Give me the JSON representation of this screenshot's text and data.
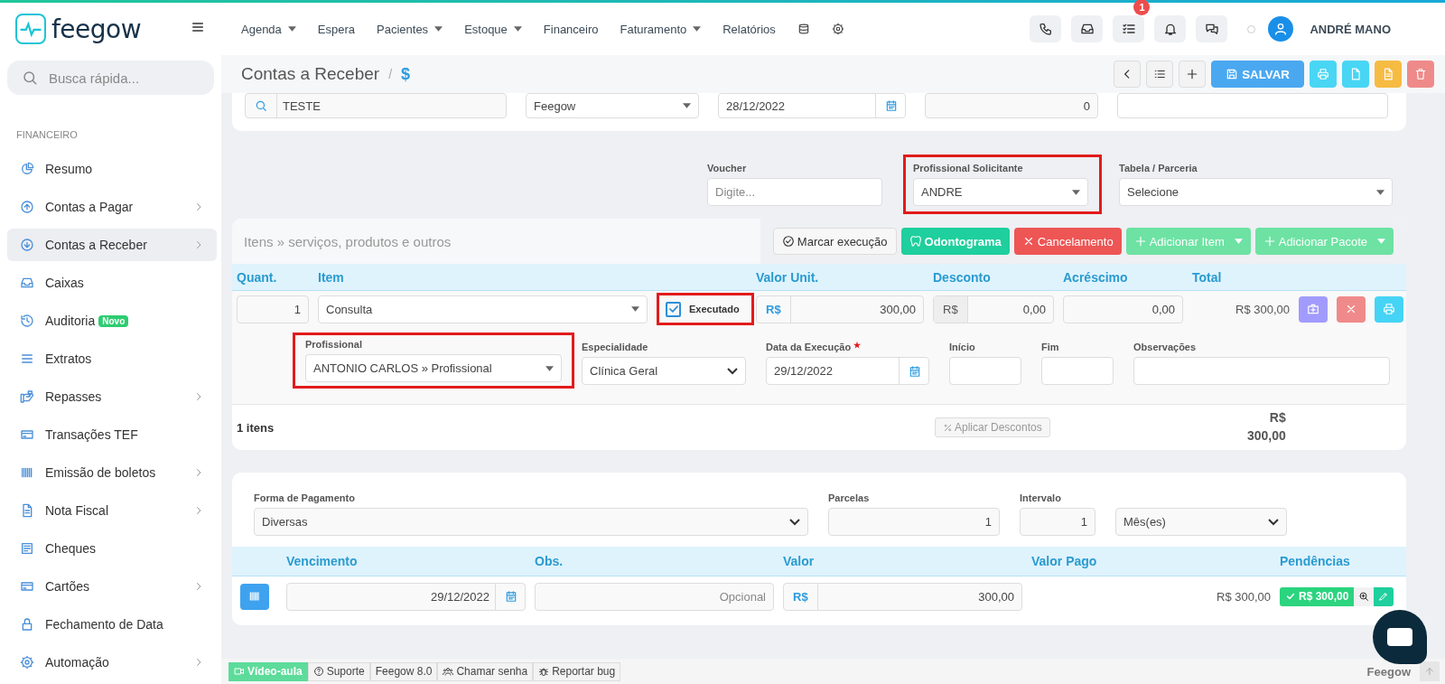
{
  "header": {
    "logo": "feegow",
    "nav": [
      {
        "label": "Agenda",
        "dropdown": true
      },
      {
        "label": "Espera",
        "dropdown": false
      },
      {
        "label": "Pacientes",
        "dropdown": true
      },
      {
        "label": "Estoque",
        "dropdown": true
      },
      {
        "label": "Financeiro",
        "dropdown": false
      },
      {
        "label": "Faturamento",
        "dropdown": true
      },
      {
        "label": "Relatórios",
        "dropdown": false
      }
    ],
    "nav_icons": [
      {
        "kind": "database"
      },
      {
        "kind": "settings"
      }
    ],
    "actions": [
      {
        "kind": "phone"
      },
      {
        "kind": "inbox"
      },
      {
        "kind": "tasks",
        "badge": "1"
      },
      {
        "kind": "bell"
      },
      {
        "kind": "chat"
      }
    ],
    "user": "ANDRÉ MANO"
  },
  "sidebar": {
    "search_placeholder": "Busca rápida...",
    "section": "FINANCEIRO",
    "items": [
      {
        "label": "Resumo",
        "kind": "pie",
        "expandable": false,
        "selected": false
      },
      {
        "label": "Contas a Pagar",
        "kind": "up",
        "expandable": true,
        "selected": false
      },
      {
        "label": "Contas a Receber",
        "kind": "down",
        "expandable": true,
        "selected": true
      },
      {
        "label": "Caixas",
        "kind": "inbox",
        "expandable": false,
        "selected": false
      },
      {
        "label": "Auditoria",
        "kind": "history",
        "expandable": false,
        "selected": false,
        "badge": "Novo"
      },
      {
        "label": "Extratos",
        "kind": "lines",
        "expandable": false,
        "selected": false
      },
      {
        "label": "Repasses",
        "kind": "hand",
        "expandable": true,
        "selected": false
      },
      {
        "label": "Transações TEF",
        "kind": "card",
        "expandable": false,
        "selected": false
      },
      {
        "label": "Emissão de boletos",
        "kind": "barcode",
        "expandable": true,
        "selected": false
      },
      {
        "label": "Nota Fiscal",
        "kind": "doc",
        "expandable": true,
        "selected": false
      },
      {
        "label": "Cheques",
        "kind": "receipt",
        "expandable": false,
        "selected": false
      },
      {
        "label": "Cartões",
        "kind": "card",
        "expandable": true,
        "selected": false
      },
      {
        "label": "Fechamento de Data",
        "kind": "lock",
        "expandable": false,
        "selected": false
      },
      {
        "label": "Automação",
        "kind": "settings",
        "expandable": true,
        "selected": false
      }
    ]
  },
  "page": {
    "title": "Contas a Receber",
    "breadcrumb_divider": "/",
    "breadcrumb": "$",
    "toolbar": [
      {
        "kind": "back"
      },
      {
        "kind": "list"
      },
      {
        "kind": "add"
      },
      {
        "kind": "save",
        "label": "SALVAR"
      },
      {
        "kind": "print"
      },
      {
        "kind": "file"
      },
      {
        "kind": "doc"
      },
      {
        "kind": "delete"
      }
    ]
  },
  "top_fields": [
    {
      "kind": "search",
      "value": "TESTE"
    },
    {
      "kind": "select",
      "value": "Feegow"
    },
    {
      "kind": "date",
      "value": "28/12/2022"
    },
    {
      "kind": "number",
      "value": "0"
    },
    {
      "kind": "textarea"
    }
  ],
  "meta_fields": [
    {
      "label": "Voucher",
      "kind": "input",
      "placeholder": "Digite...",
      "highlighted": false
    },
    {
      "label": "Profissional Solicitante",
      "kind": "select",
      "value": "ANDRE",
      "highlighted": true
    },
    {
      "label": "Tabela / Parceria",
      "kind": "select",
      "value": "Selecione",
      "highlighted": false
    }
  ],
  "items": {
    "title": "Itens » serviços, produtos e outros",
    "actions": [
      {
        "label": "Marcar execução",
        "kind": "outline",
        "dropdown": false
      },
      {
        "label": "Odontograma",
        "kind": "tooth",
        "dropdown": false
      },
      {
        "label": "Cancelamento",
        "kind": "cancel",
        "dropdown": false
      },
      {
        "label": "Adicionar Item",
        "kind": "add",
        "dropdown": true
      },
      {
        "label": "Adicionar Pacote",
        "kind": "add",
        "dropdown": true
      }
    ],
    "columns": [
      "Quant.",
      "Item",
      "Valor Unit.",
      "Desconto",
      "Acréscimo",
      "Total"
    ],
    "row": {
      "quantity": "1",
      "item": "Consulta",
      "executed": {
        "label": "Executado",
        "checked": true,
        "highlighted": true
      },
      "unit_currency": "R$",
      "unit_value": "300,00",
      "discount_currency": "R$",
      "discount_value": "0,00",
      "surcharge": "0,00",
      "total": "R$ 300,00",
      "row_actions": [
        {
          "kind": "medkit"
        },
        {
          "kind": "remove"
        },
        {
          "kind": "print"
        }
      ]
    },
    "detail": [
      {
        "label": "Profissional",
        "kind": "select",
        "value": "ANTONIO CARLOS » Profissional",
        "highlighted": true,
        "required": false
      },
      {
        "label": "Especialidade",
        "kind": "native-select",
        "value": "Clínica Geral",
        "highlighted": false,
        "required": false
      },
      {
        "label": "Data da Execução",
        "kind": "date",
        "value": "29/12/2022",
        "highlighted": false,
        "required": true
      },
      {
        "label": "Início",
        "kind": "input",
        "highlighted": false,
        "required": false
      },
      {
        "label": "Fim",
        "kind": "input",
        "highlighted": false,
        "required": false
      },
      {
        "label": "Observações",
        "kind": "input",
        "highlighted": false,
        "required": false
      }
    ],
    "count": "1 itens",
    "discount_button": "Aplicar Descontos",
    "total": "R$ 300,00"
  },
  "payment": {
    "fields": [
      {
        "label": "Forma de Pagamento",
        "kind": "native-select",
        "value": "Diversas"
      },
      {
        "label": "Parcelas",
        "kind": "number",
        "value": "1"
      },
      {
        "label": "Intervalo",
        "kind": "number",
        "value": "1"
      },
      {
        "kind": "native-select",
        "value": "Mês(es)"
      }
    ],
    "columns": [
      "Vencimento",
      "Obs.",
      "Valor",
      "Valor Pago",
      "Pendências"
    ],
    "row": {
      "due": "29/12/2022",
      "obs_placeholder": "Opcional",
      "currency": "R$",
      "value": "300,00",
      "paid": "R$ 300,00",
      "pending": "R$ 300,00"
    }
  },
  "footer": {
    "links": [
      {
        "kind": "video",
        "label": "Vídeo-aula",
        "primary": true
      },
      {
        "kind": "help",
        "label": "Suporte",
        "primary": false
      },
      {
        "kind": "none",
        "label": "Feegow 8.0",
        "primary": false
      },
      {
        "kind": "users",
        "label": "Chamar senha",
        "primary": false
      },
      {
        "kind": "bug",
        "label": "Reportar bug",
        "primary": false
      }
    ],
    "brand": "Feegow"
  }
}
